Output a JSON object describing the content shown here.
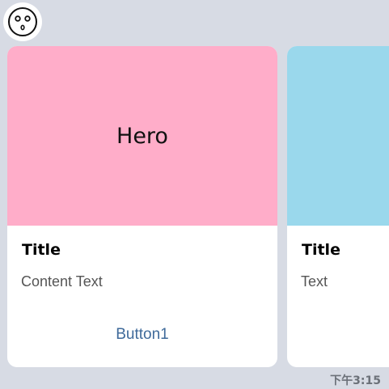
{
  "avatar": {
    "icon": "face-icon"
  },
  "cards": [
    {
      "hero_label": "Hero",
      "hero_color": "#ffadc9",
      "title": "Title",
      "text": "Content Text",
      "button_label": "Button1"
    },
    {
      "hero_label": "",
      "hero_color": "#9ad8ec",
      "title": "Title",
      "text": "Text"
    }
  ],
  "status": {
    "time": "下午3:15"
  },
  "colors": {
    "background": "#d7dbe4",
    "card": "#ffffff",
    "button_text": "#3f6a9a"
  }
}
